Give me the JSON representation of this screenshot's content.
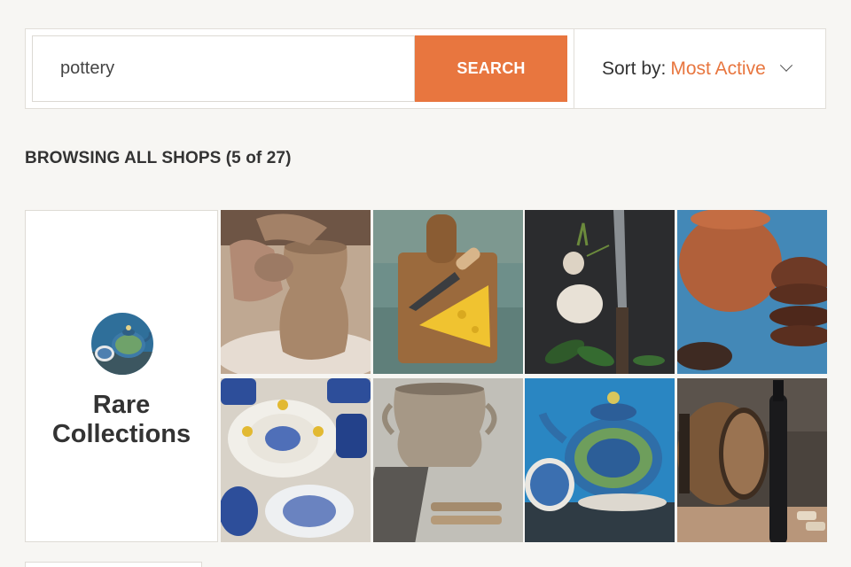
{
  "search": {
    "value": "pottery",
    "button_label": "SEARCH"
  },
  "sort": {
    "label": "Sort by:",
    "value": "Most Active"
  },
  "listing": {
    "heading": "BROWSING ALL SHOPS (5 of 27)"
  },
  "shop": {
    "name_line1": "Rare",
    "name_line2": "Collections",
    "photos": [
      "clay pot on potter's wheel",
      "cheese on cutting board with knife",
      "garlic and herbs with knife",
      "terracotta pot and clay bowls",
      "blue and white painted plates",
      "beige clay jug on wood",
      "blue painted teapot and bowl",
      "wine barrel and dark bottle"
    ]
  },
  "colors": {
    "accent": "#e8763f",
    "background": "#f7f6f3",
    "text": "#333333"
  },
  "icons": {
    "sort_dropdown": "chevron-down-icon"
  }
}
